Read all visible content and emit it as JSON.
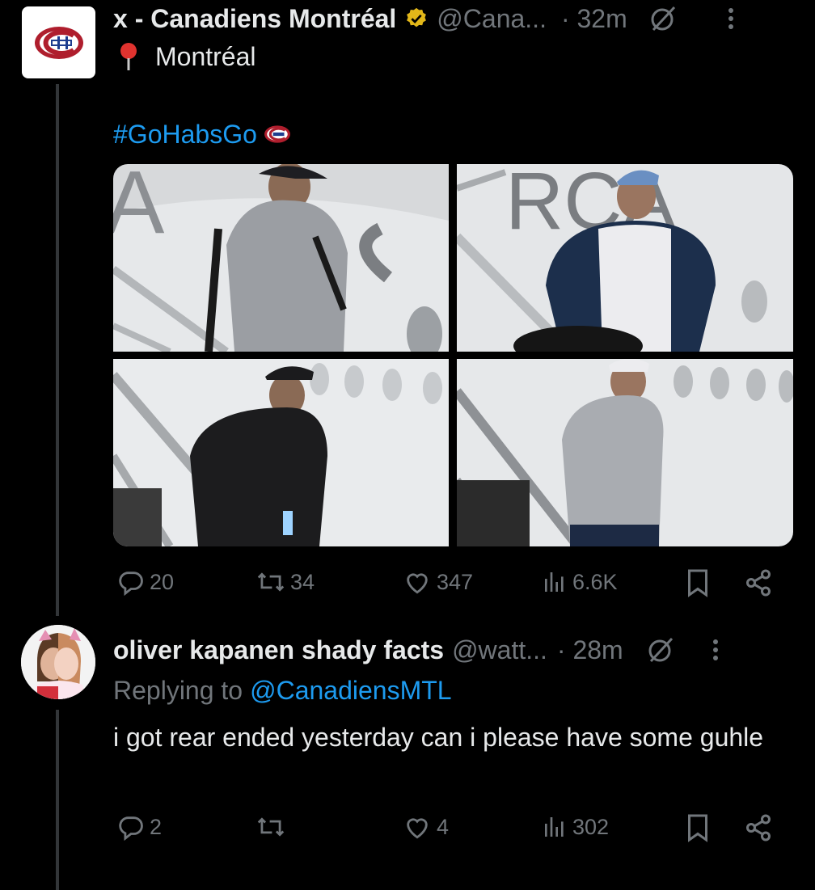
{
  "post": {
    "display_name": "x - Canadiens Montréal",
    "handle": "@Cana...",
    "time": "· 32m",
    "location": "Montréal",
    "hashtag": "#GoHabsGo",
    "photos": [
      {
        "desc": "player in grey quarter-zip with cap descending plane stairs"
      },
      {
        "desc": "player in navy jacket with blue cap"
      },
      {
        "desc": "player in black long sleeve with water bottle"
      },
      {
        "desc": "player in grey hoodie with white cap"
      }
    ],
    "actions": {
      "replies": "20",
      "reposts": "34",
      "likes": "347",
      "views": "6.6K"
    }
  },
  "reply": {
    "display_name": "oliver kapanen shady facts",
    "handle": "@watt...",
    "time": "· 28m",
    "replying_prefix": "Replying to",
    "replying_to": "@CanadiensMTL",
    "text": "i got rear ended yesterday can i please have some guhle",
    "actions": {
      "replies": "2",
      "reposts": "",
      "likes": "4",
      "views": "302"
    }
  },
  "colors": {
    "background": "#000000",
    "text": "#e7e9ea",
    "secondary": "#71767b",
    "accent": "#1d9bf0",
    "verified": "#e2b719"
  }
}
